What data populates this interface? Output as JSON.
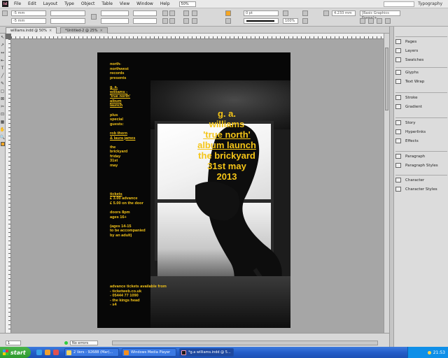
{
  "menubar": {
    "logo": "Id",
    "items": [
      "File",
      "Edit",
      "Layout",
      "Type",
      "Object",
      "Table",
      "View",
      "Window",
      "Help"
    ],
    "zoom": "50%",
    "workspace": "Typography"
  },
  "control": {
    "x_field": "-5 mm",
    "y_field": "-5 mm",
    "stroke_weight": "0 pt",
    "opacity": "100%",
    "offset": "4.233 mm",
    "object_style": "[Basic Graphics Frame]+"
  },
  "tabs": [
    {
      "label": "williams.indd @ 50%",
      "active": true
    },
    {
      "label": "*Untitled-2 @ 25%",
      "active": false
    }
  ],
  "tools": [
    "↖",
    "↗",
    "↔",
    "⇤",
    "T",
    "╱",
    "✎",
    "▢",
    "⊠",
    "✂",
    "⊡",
    "▦",
    "✋",
    "🔍"
  ],
  "poster": {
    "left_column": [
      [
        "north-",
        "northwest",
        "records",
        "presents"
      ],
      [
        "g. a.",
        "williams -",
        "'true north'",
        "album",
        "launch"
      ],
      [
        "plus",
        "special",
        "guests:"
      ],
      [
        "rob thorn",
        "& laura james"
      ],
      [
        "the",
        "brickyard",
        "friday",
        "31st",
        "may"
      ],
      [
        "tickets",
        "£ 3.00 advance",
        "£ 5.00 on the door"
      ],
      [
        "doors 8pm",
        "ages 16+"
      ],
      [
        "(ages 14-15",
        "to be accompanied",
        "by an adult)"
      ]
    ],
    "advance": [
      "advance tickets available from",
      "- ticketweb.co.uk",
      "- 05444 77 1090",
      "- the kings head",
      "- s4"
    ],
    "headline": [
      "g. a.",
      "williams",
      "'true north'",
      "album launch",
      "the brickyard",
      "31st may",
      "2013"
    ]
  },
  "panels": {
    "group1": [
      "Pages",
      "Layers",
      "Swatches"
    ],
    "group2": [
      "Glyphs",
      "Text Wrap"
    ],
    "group3": [
      "Stroke",
      "Gradient"
    ],
    "group4": [
      "Story",
      "Hyperlinks",
      "Effects"
    ],
    "group5": [
      "Paragraph",
      "Paragraph Styles"
    ],
    "group6": [
      "Character",
      "Character Styles"
    ]
  },
  "status": {
    "page": "1",
    "preflight": "No errors"
  },
  "taskbar": {
    "start": "start",
    "buttons": [
      {
        "label": "2 Vers - 92688 (Mar)..."
      },
      {
        "label": "Windows Media Player"
      },
      {
        "label": "*g.a williams.indd @ 5..."
      }
    ],
    "clock": "21:53"
  },
  "colors": {
    "accent_yellow": "#f5c518",
    "fill_orange": "#f5a623",
    "taskbar_blue": "#245dc9"
  }
}
